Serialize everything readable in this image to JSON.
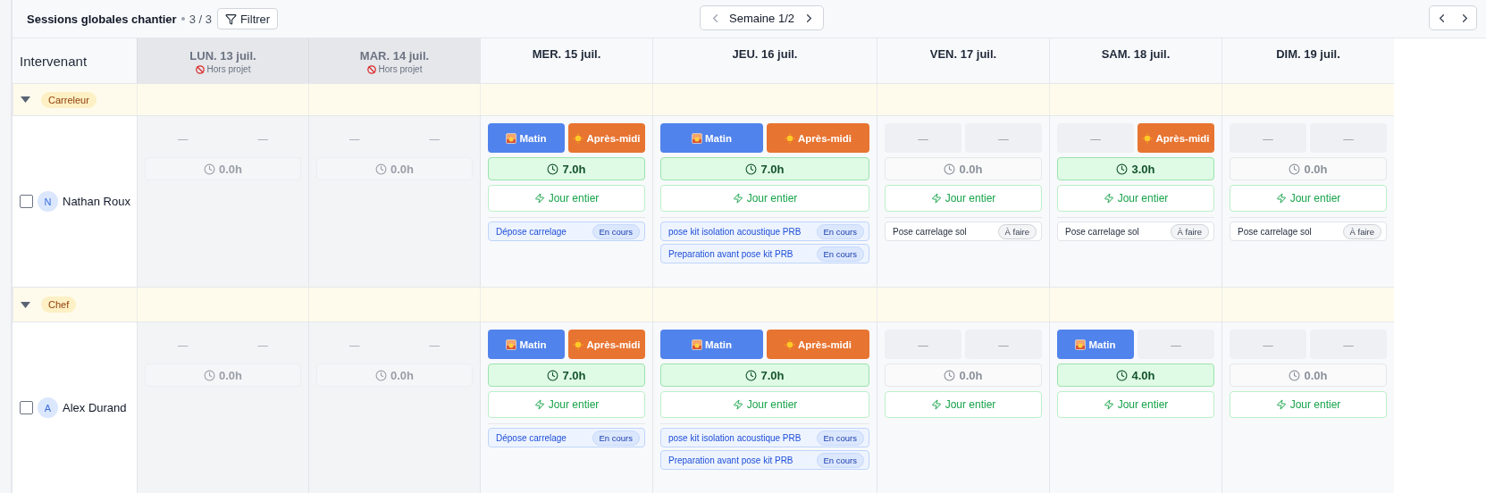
{
  "toolbar": {
    "title": "Sessions globales chantier",
    "count": "3 / 3",
    "filter_button": "Filtrer",
    "week_label": "Semaine 1/2"
  },
  "grid": {
    "corner_label": "Intervenant",
    "days": [
      {
        "label": "LUN. 13 juil.",
        "off_project": true,
        "note": "Hors projet"
      },
      {
        "label": "MAR. 14 juil.",
        "off_project": true,
        "note": "Hors projet"
      },
      {
        "label": "MER. 15 juil.",
        "off_project": false
      },
      {
        "label": "JEU. 16 juil.",
        "off_project": false
      },
      {
        "label": "VEN. 17 juil.",
        "off_project": false
      },
      {
        "label": "SAM. 18 juil.",
        "off_project": false
      },
      {
        "label": "DIM. 19 juil.",
        "off_project": false
      }
    ],
    "groups": [
      {
        "label": "Carreleur",
        "expanded": true,
        "people": [
          {
            "name": "Nathan Roux",
            "initial": "N",
            "checked": false,
            "days": [
              {
                "disabled": true,
                "morning": {
                  "label": "—",
                  "on": false
                },
                "afternoon": {
                  "label": "—",
                  "on": false
                },
                "hours": "0.0h",
                "worked": false
              },
              {
                "disabled": true,
                "morning": {
                  "label": "—",
                  "on": false
                },
                "afternoon": {
                  "label": "—",
                  "on": false
                },
                "hours": "0.0h",
                "worked": false
              },
              {
                "disabled": false,
                "morning": {
                  "label": "Matin",
                  "on": true
                },
                "afternoon": {
                  "label": "Après-midi",
                  "on": true
                },
                "hours": "7.0h",
                "worked": true,
                "full_day": "Jour entier",
                "tasks": [
                  {
                    "title": "Dépose carrelage",
                    "status": "En cours",
                    "kind": "in_progress"
                  }
                ]
              },
              {
                "disabled": false,
                "morning": {
                  "label": "Matin",
                  "on": true
                },
                "afternoon": {
                  "label": "Après-midi",
                  "on": true
                },
                "hours": "7.0h",
                "worked": true,
                "full_day": "Jour entier",
                "tasks": [
                  {
                    "title": "pose kit isolation acoustique PRB",
                    "status": "En cours",
                    "kind": "in_progress"
                  },
                  {
                    "title": "Preparation avant pose kit PRB",
                    "status": "En cours",
                    "kind": "in_progress"
                  }
                ]
              },
              {
                "disabled": false,
                "morning": {
                  "label": "—",
                  "on": false
                },
                "afternoon": {
                  "label": "—",
                  "on": false
                },
                "hours": "0.0h",
                "worked": false,
                "full_day": "Jour entier",
                "tasks": [
                  {
                    "title": "Pose carrelage sol",
                    "status": "À faire",
                    "kind": "todo"
                  }
                ]
              },
              {
                "disabled": false,
                "morning": {
                  "label": "—",
                  "on": false
                },
                "afternoon": {
                  "label": "Après-midi",
                  "on": true
                },
                "hours": "3.0h",
                "worked": true,
                "full_day": "Jour entier",
                "tasks": [
                  {
                    "title": "Pose carrelage sol",
                    "status": "À faire",
                    "kind": "todo"
                  }
                ]
              },
              {
                "disabled": false,
                "morning": {
                  "label": "—",
                  "on": false
                },
                "afternoon": {
                  "label": "—",
                  "on": false
                },
                "hours": "0.0h",
                "worked": false,
                "full_day": "Jour entier",
                "tasks": [
                  {
                    "title": "Pose carrelage sol",
                    "status": "À faire",
                    "kind": "todo"
                  }
                ]
              }
            ]
          }
        ]
      },
      {
        "label": "Chef",
        "expanded": true,
        "people": [
          {
            "name": "Alex Durand",
            "initial": "A",
            "checked": false,
            "days": [
              {
                "disabled": true,
                "morning": {
                  "label": "—",
                  "on": false
                },
                "afternoon": {
                  "label": "—",
                  "on": false
                },
                "hours": "0.0h",
                "worked": false
              },
              {
                "disabled": true,
                "morning": {
                  "label": "—",
                  "on": false
                },
                "afternoon": {
                  "label": "—",
                  "on": false
                },
                "hours": "0.0h",
                "worked": false
              },
              {
                "disabled": false,
                "morning": {
                  "label": "Matin",
                  "on": true
                },
                "afternoon": {
                  "label": "Après-midi",
                  "on": true
                },
                "hours": "7.0h",
                "worked": true,
                "full_day": "Jour entier",
                "tasks": [
                  {
                    "title": "Dépose carrelage",
                    "status": "En cours",
                    "kind": "in_progress"
                  }
                ]
              },
              {
                "disabled": false,
                "morning": {
                  "label": "Matin",
                  "on": true
                },
                "afternoon": {
                  "label": "Après-midi",
                  "on": true
                },
                "hours": "7.0h",
                "worked": true,
                "full_day": "Jour entier",
                "tasks": [
                  {
                    "title": "pose kit isolation acoustique PRB",
                    "status": "En cours",
                    "kind": "in_progress"
                  },
                  {
                    "title": "Preparation avant pose kit PRB",
                    "status": "En cours",
                    "kind": "in_progress"
                  }
                ]
              },
              {
                "disabled": false,
                "morning": {
                  "label": "—",
                  "on": false
                },
                "afternoon": {
                  "label": "—",
                  "on": false
                },
                "hours": "0.0h",
                "worked": false,
                "full_day": "Jour entier"
              },
              {
                "disabled": false,
                "morning": {
                  "label": "Matin",
                  "on": true
                },
                "afternoon": {
                  "label": "—",
                  "on": false
                },
                "hours": "4.0h",
                "worked": true,
                "full_day": "Jour entier"
              },
              {
                "disabled": false,
                "morning": {
                  "label": "—",
                  "on": false
                },
                "afternoon": {
                  "label": "—",
                  "on": false
                },
                "hours": "0.0h",
                "worked": false,
                "full_day": "Jour entier"
              }
            ]
          }
        ]
      }
    ]
  }
}
